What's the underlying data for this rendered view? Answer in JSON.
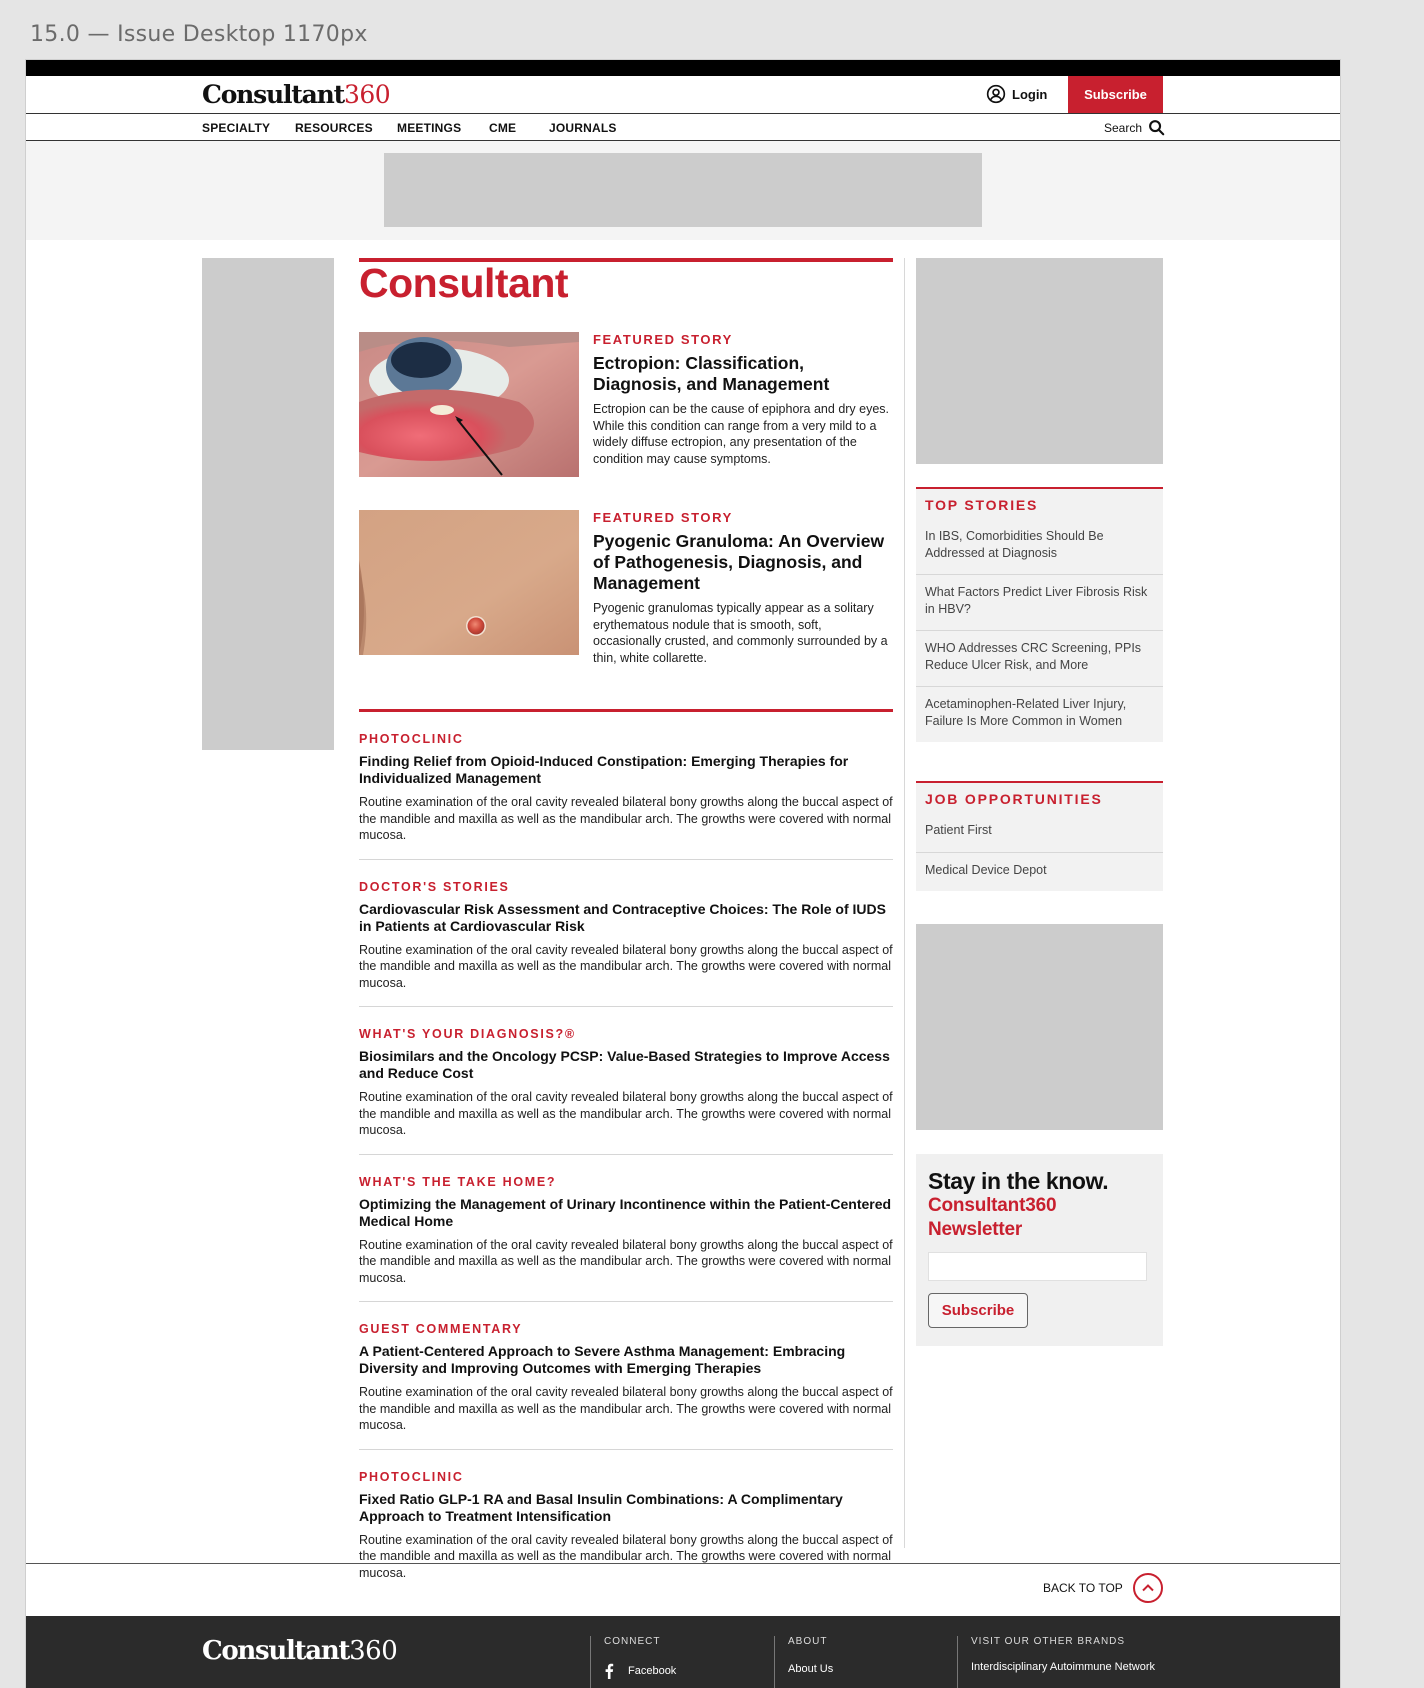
{
  "frame_label": "15.0 — Issue Desktop 1170px",
  "header": {
    "logo_word": "Consultant",
    "logo_num": "360",
    "login_label": "Login",
    "subscribe_label": "Subscribe"
  },
  "nav": {
    "items": [
      "SPECIALTY",
      "RESOURCES",
      "MEETINGS",
      "CME",
      "JOURNALS"
    ],
    "search_label": "Search"
  },
  "main": {
    "brand_title": "Consultant",
    "featured": [
      {
        "kicker": "FEATURED STORY",
        "title": "Ectropion: Classification, Diagnosis, and Management",
        "description": "Ectropion can be the cause of epiphora and dry eyes. While this condition can range from a very mild to a widely diffuse ectropion, any presentation of the condition may cause symptoms."
      },
      {
        "kicker": "FEATURED STORY",
        "title": "Pyogenic Granuloma: An Overview of Pathogenesis, Diagnosis, and Management",
        "description": "Pyogenic granulomas typically appear as a solitary erythematous nodule that is smooth, soft, occasionally crusted, and commonly surrounded by a thin, white collarette."
      }
    ],
    "articles": [
      {
        "kicker": "PHOTOCLINIC",
        "title": "Finding Relief from Opioid-Induced Constipation: Emerging Therapies for Individualized Management",
        "description": "Routine examination of the oral cavity revealed bilateral bony growths along the buccal aspect of the mandible and maxilla as well as the mandibular arch. The growths were covered with normal mucosa."
      },
      {
        "kicker": "DOCTOR'S STORIES",
        "title": "Cardiovascular Risk Assessment and Contraceptive Choices: The Role of IUDS in Patients at Cardiovascular Risk",
        "description": "Routine examination of the oral cavity revealed bilateral bony growths along the buccal aspect of the mandible and maxilla as well as the mandibular arch. The growths were covered with normal mucosa."
      },
      {
        "kicker": "WHAT'S YOUR DIAGNOSIS?®",
        "title": "Biosimilars and the Oncology PCSP: Value-Based Strategies to Improve Access and Reduce Cost",
        "description": "Routine examination of the oral cavity revealed bilateral bony growths along the buccal aspect of the mandible and maxilla as well as the mandibular arch. The growths were covered with normal mucosa."
      },
      {
        "kicker": "WHAT'S THE TAKE HOME?",
        "title": "Optimizing the Management of Urinary Incontinence within the Patient-Centered Medical Home",
        "description": "Routine examination of the oral cavity revealed bilateral bony growths along the buccal aspect of the mandible and maxilla as well as the mandibular arch. The growths were covered with normal mucosa."
      },
      {
        "kicker": "GUEST COMMENTARY",
        "title": "A Patient-Centered Approach to Severe Asthma Management: Embracing Diversity and Improving Outcomes with Emerging Therapies",
        "description": "Routine examination of the oral cavity revealed bilateral bony growths along the buccal aspect of the mandible and maxilla as well as the mandibular arch. The growths were covered with normal mucosa."
      },
      {
        "kicker": "PHOTOCLINIC",
        "title": "Fixed Ratio GLP-1 RA and Basal Insulin Combinations: A Complimentary Approach to Treatment Intensification",
        "description": "Routine examination of the oral cavity revealed bilateral bony growths along the buccal aspect of the mandible and maxilla as well as the mandibular arch. The growths were covered with normal mucosa."
      }
    ]
  },
  "sidebar": {
    "top_stories": {
      "title": "TOP STORIES",
      "items": [
        "In IBS, Comorbidities Should Be Addressed at Diagnosis",
        "What Factors Predict Liver Fibrosis Risk in HBV?",
        "WHO Addresses CRC Screening, PPIs Reduce Ulcer Risk, and More",
        "Acetaminophen-Related Liver Injury, Failure Is More Common in Women"
      ]
    },
    "jobs": {
      "title": "JOB OPPORTUNITIES",
      "items": [
        "Patient First",
        "Medical Device Depot"
      ]
    },
    "newsletter": {
      "heading": "Stay in the know.",
      "subheading": "Consultant360 Newsletter",
      "input_value": "",
      "button_label": "Subscribe"
    }
  },
  "back_to_top_label": "BACK TO TOP",
  "footer": {
    "logo_word": "Consultant",
    "logo_num": "360",
    "connect_heading": "CONNECT",
    "connect_link": "Facebook",
    "about_heading": "ABOUT",
    "about_link": "About Us",
    "brands_heading": "VISIT OUR OTHER BRANDS",
    "brands_link": "Interdisciplinary Autoimmune Network"
  },
  "colors": {
    "brand_red": "#c8202f",
    "footer_bg": "#2b2b2b",
    "ad_placeholder": "#cccccc"
  }
}
